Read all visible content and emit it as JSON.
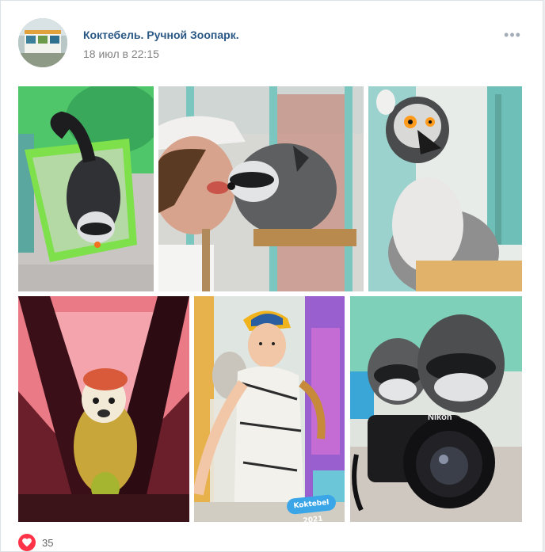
{
  "post": {
    "author": "Коктебель. Ручной Зоопарк.",
    "date": "18 июл в 22:15",
    "menu_icon": "more-dots-icon",
    "likes": {
      "count": "35",
      "icon": "heart-icon",
      "color": "#ff3347"
    },
    "photos": [
      {
        "subject": "raccoon-in-green-basin-photo"
      },
      {
        "subject": "girl-feeding-raccoon-photo"
      },
      {
        "subject": "ring-tailed-lemur-photo"
      },
      {
        "subject": "squirrel-monkey-in-hammock-photo"
      },
      {
        "subject": "boy-in-cap-photo",
        "badge_text": "Koktebel 2021"
      },
      {
        "subject": "raccoons-with-nikon-camera-photo",
        "camera_brand": "Nikon"
      }
    ]
  },
  "colors": {
    "link": "#2a5885",
    "meta": "#828282",
    "card_bg": "#ffffff",
    "page_bg": "#edeef0"
  }
}
